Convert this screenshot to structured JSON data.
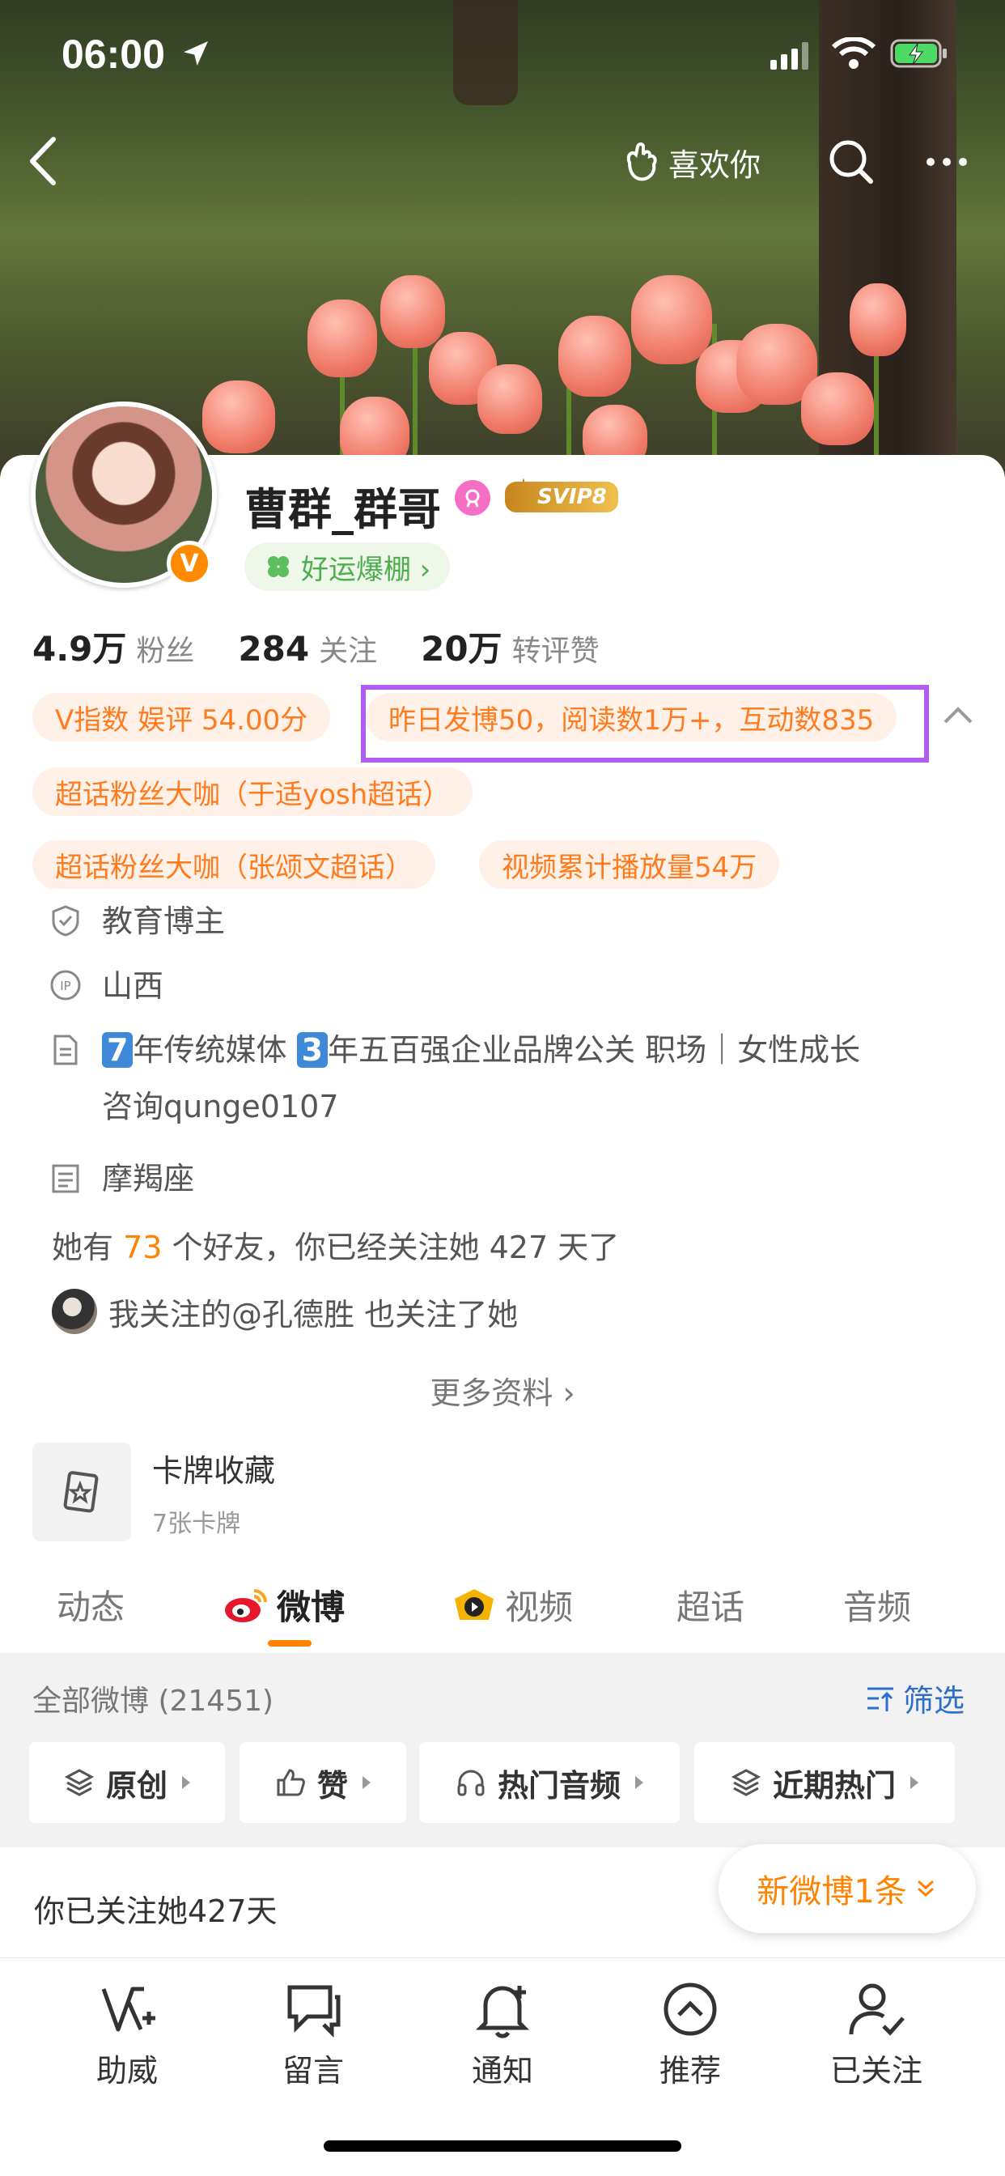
{
  "status_bar": {
    "time": "06:00"
  },
  "nav": {
    "like_label": "喜欢你"
  },
  "profile": {
    "name": "曹群_群哥",
    "svip_label": "SVIP8",
    "vip_badge": "V",
    "lucky_label": "好运爆棚 ›",
    "stats": [
      {
        "value": "4.9万",
        "label": "粉丝"
      },
      {
        "value": "284",
        "label": "关注"
      },
      {
        "value": "20万",
        "label": "转评赞"
      }
    ],
    "tags": {
      "v_index": "V指数 娱评 54.00分",
      "yesterday": "昨日发博50，阅读数1万+，互动数835",
      "super_fan_1": "超话粉丝大咖（于适yosh超话）",
      "super_fan_2": "超话粉丝大咖（张颂文超话）",
      "video_plays": "视频累计播放量54万"
    },
    "info": {
      "certification": "教育博主",
      "location": "山西",
      "bio_num1": "7",
      "bio_part1": "年传统媒体",
      "bio_num2": "3",
      "bio_part2": "年五百强企业品牌公关 职场｜女性成长",
      "bio_line2": "咨询qunge0107",
      "zodiac": "摩羯座"
    },
    "friends": {
      "prefix": "她有 ",
      "count": "73",
      "suffix": " 个好友，你已经关注她 427 天了"
    },
    "mutual": "我关注的@孔德胜 也关注了她",
    "more_info": "更多资料 ›",
    "cards": {
      "title": "卡牌收藏",
      "subtitle": "7张卡牌"
    }
  },
  "tabs": [
    {
      "label": "动态"
    },
    {
      "label": "微博"
    },
    {
      "label": "视频"
    },
    {
      "label": "超话"
    },
    {
      "label": "音频"
    }
  ],
  "feed_filter": {
    "all_label": "全部微博 (21451)",
    "filter_label": "筛选",
    "chips": [
      "原创",
      "赞",
      "热门音频",
      "近期热门"
    ]
  },
  "followed_days": "你已关注她427天",
  "new_weibo": "新微博1条",
  "bottom_bar": [
    {
      "label": "助威",
      "icon": "cheer-icon"
    },
    {
      "label": "留言",
      "icon": "message-icon"
    },
    {
      "label": "通知",
      "icon": "bell-icon"
    },
    {
      "label": "推荐",
      "icon": "recommend-icon"
    },
    {
      "label": "已关注",
      "icon": "followed-user-icon"
    }
  ],
  "colors": {
    "accent": "#ff8200",
    "highlight_box": "#b15df0",
    "filter_blue": "#2f6fc9",
    "tag_bg": "#fff1e8"
  }
}
